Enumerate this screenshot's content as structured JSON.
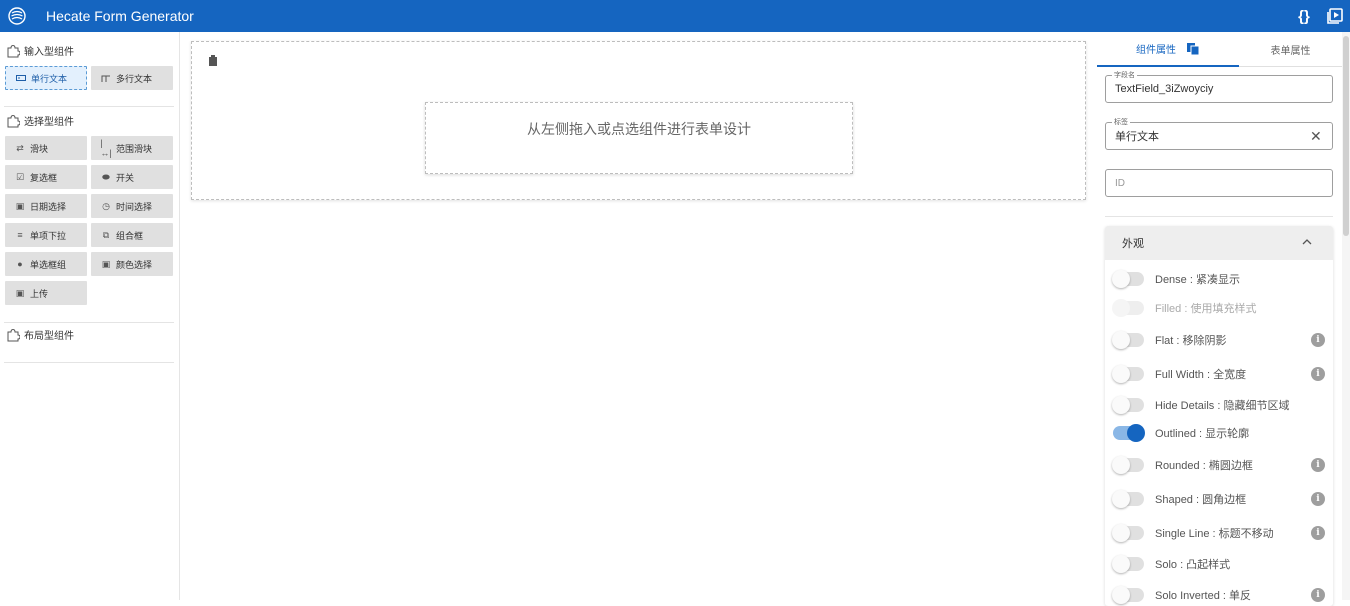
{
  "app": {
    "title": "Hecate Form Generator",
    "accent": "#1565c0",
    "actions": [
      {
        "icon": "code-braces-icon",
        "label": "{}"
      },
      {
        "icon": "preview-icon"
      }
    ]
  },
  "palette": {
    "groups": [
      {
        "title": "输入型组件",
        "icon": "puzzle-icon"
      },
      {
        "title": "选择型组件",
        "icon": "puzzle-icon"
      },
      {
        "title": "布局型组件",
        "icon": "puzzle-icon"
      }
    ],
    "input_items": [
      {
        "label": "单行文本",
        "icon": "textbox-icon",
        "active": true
      },
      {
        "label": "多行文本",
        "icon": "textarea-icon"
      }
    ],
    "select_items": [
      {
        "label": "滑块",
        "icon": "slider-icon"
      },
      {
        "label": "范围滑块",
        "icon": "range-slider-icon"
      },
      {
        "label": "复选框",
        "icon": "checkbox-icon"
      },
      {
        "label": "开关",
        "icon": "toggle-icon"
      },
      {
        "label": "日期选择",
        "icon": "calendar-icon"
      },
      {
        "label": "时间选择",
        "icon": "clock-icon"
      },
      {
        "label": "单项下拉",
        "icon": "dropdown-icon"
      },
      {
        "label": "组合框",
        "icon": "combobox-icon"
      },
      {
        "label": "单选框组",
        "icon": "radio-icon"
      },
      {
        "label": "颜色选择",
        "icon": "palette-icon"
      },
      {
        "label": "上传",
        "icon": "upload-icon"
      }
    ]
  },
  "canvas": {
    "placeholder": "从左侧拖入或点选组件进行表单设计"
  },
  "properties": {
    "tabs": [
      {
        "label": "组件属性",
        "active": true
      },
      {
        "label": "表单属性"
      }
    ],
    "fields": {
      "field_name_legend": "字段名",
      "field_name_value": "TextField_3iZwoyciy",
      "label_legend": "标签",
      "label_value": "单行文本",
      "id_placeholder": "ID"
    },
    "appearance": {
      "title": "外观",
      "options": [
        {
          "label": "Dense : 紧凑显示",
          "on": false,
          "info": false,
          "disabled": false
        },
        {
          "label": "Filled : 使用填充样式",
          "on": false,
          "info": false,
          "disabled": true
        },
        {
          "label": "Flat : 移除阴影",
          "on": false,
          "info": true,
          "disabled": false
        },
        {
          "label": "Full Width : 全宽度",
          "on": false,
          "info": true,
          "disabled": false
        },
        {
          "label": "Hide Details : 隐藏细节区域",
          "on": false,
          "info": false,
          "disabled": false
        },
        {
          "label": "Outlined : 显示轮廓",
          "on": true,
          "info": false,
          "disabled": false
        },
        {
          "label": "Rounded : 椭圆边框",
          "on": false,
          "info": true,
          "disabled": false
        },
        {
          "label": "Shaped : 圆角边框",
          "on": false,
          "info": true,
          "disabled": false
        },
        {
          "label": "Single Line : 标题不移动",
          "on": false,
          "info": true,
          "disabled": false
        },
        {
          "label": "Solo : 凸起样式",
          "on": false,
          "info": false,
          "disabled": false
        },
        {
          "label": "Solo Inverted : 单反",
          "on": false,
          "info": true,
          "disabled": false
        }
      ]
    }
  }
}
